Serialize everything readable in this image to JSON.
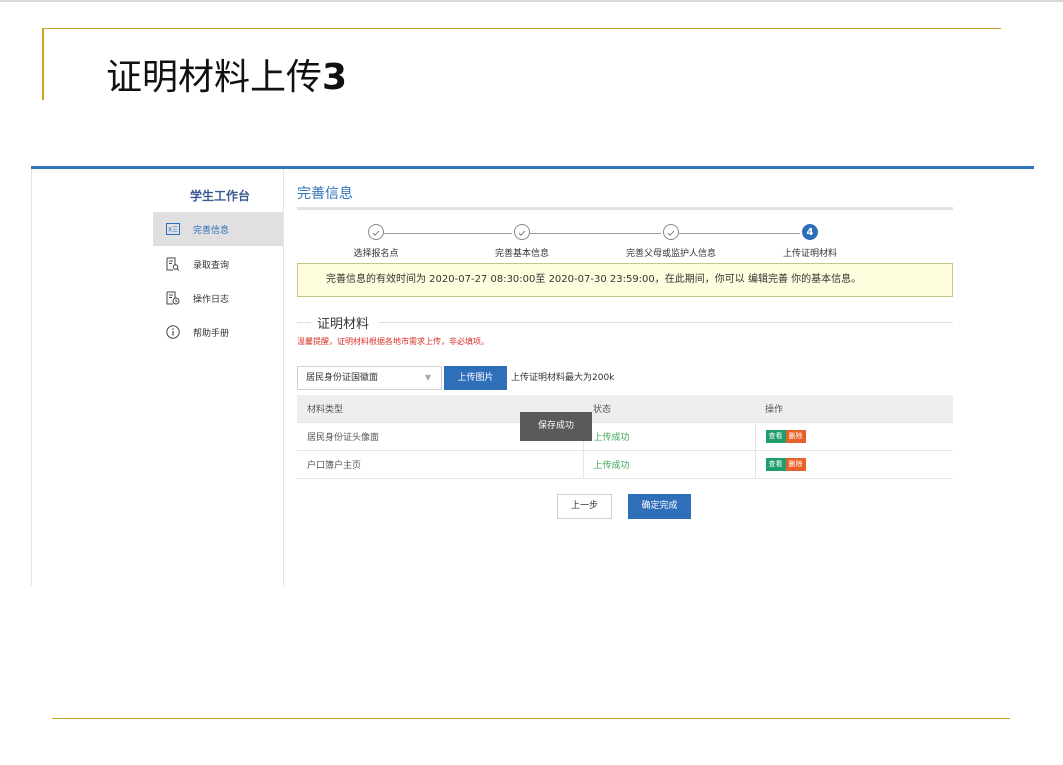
{
  "slide": {
    "title_text": "证明材料上传",
    "title_number": "3"
  },
  "sidebar": {
    "title": "学生工作台",
    "items": [
      {
        "label": "完善信息",
        "icon": "id-card-icon",
        "active": true
      },
      {
        "label": "录取查询",
        "icon": "search-document-icon",
        "active": false
      },
      {
        "label": "操作日志",
        "icon": "log-clock-icon",
        "active": false
      },
      {
        "label": "帮助手册",
        "icon": "info-icon",
        "active": false
      }
    ]
  },
  "main": {
    "title": "完善信息",
    "steps": [
      {
        "label": "选择报名点",
        "status": "done"
      },
      {
        "label": "完善基本信息",
        "status": "done"
      },
      {
        "label": "完善父母或监护人信息",
        "status": "done"
      },
      {
        "label": "上传证明材料",
        "status": "current",
        "number": "4"
      }
    ],
    "notice": "完善信息的有效时间为 2020-07-27 08:30:00至 2020-07-30 23:59:00，在此期间，你可以 编辑完善 你的基本信息。",
    "section_title": "证明材料",
    "warning": "温馨提醒，证明材料根据各地市需求上传，非必填项。",
    "upload": {
      "selected_type": "居民身份证国徽面",
      "button_label": "上传图片",
      "hint": "上传证明材料最大为200k"
    },
    "table": {
      "headers": [
        "材料类型",
        "状态",
        "操作"
      ],
      "rows": [
        {
          "type": "居民身份证头像面",
          "status": "上传成功",
          "view": "查看",
          "delete": "删除"
        },
        {
          "type": "户口簿户主页",
          "status": "上传成功",
          "view": "查看",
          "delete": "删除"
        }
      ]
    },
    "toast": "保存成功",
    "prev_label": "上一步",
    "done_label": "确定完成"
  },
  "colors": {
    "accent": "#2f6fb9",
    "gold": "#c9a227",
    "success": "#3ca455",
    "view": "#1e9e6b",
    "delete": "#e9612a",
    "warning": "#d9302a"
  }
}
